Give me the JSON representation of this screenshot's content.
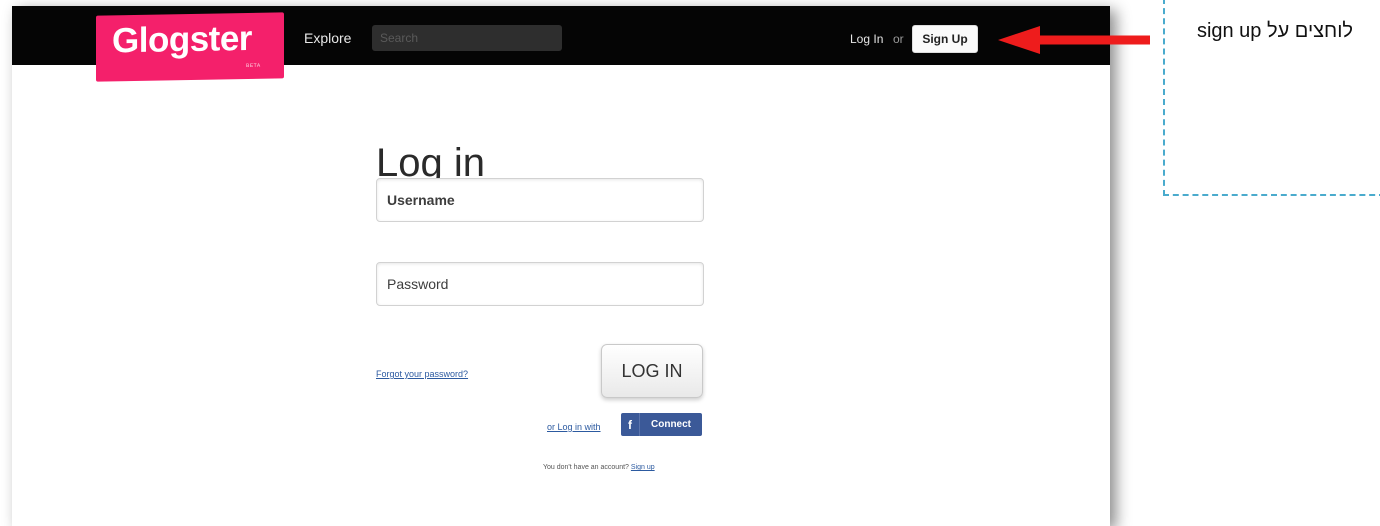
{
  "header": {
    "logo": "Glogster",
    "logo_tag": "BETA",
    "nav_explore": "Explore",
    "search_placeholder": "Search",
    "login_link": "Log In",
    "or": "or",
    "signup_button": "Sign Up"
  },
  "form": {
    "title": "Log in",
    "username_placeholder": "Username",
    "password_placeholder": "Password",
    "forgot_link": "Forgot your password?",
    "login_button": "LOG IN",
    "alt_login_text": "or Log in with",
    "facebook_icon": "f",
    "facebook_button": "Connect",
    "no_account_text": "You don't have an account?",
    "signup_link": "Sign up"
  },
  "annotation": {
    "note_text": "לוחצים על sign up",
    "arrow_color": "#ee1c1c",
    "border_color": "#4aabcd"
  },
  "colors": {
    "brand_pink": "#f4206b",
    "topbar": "#050505",
    "facebook": "#3b5998"
  }
}
